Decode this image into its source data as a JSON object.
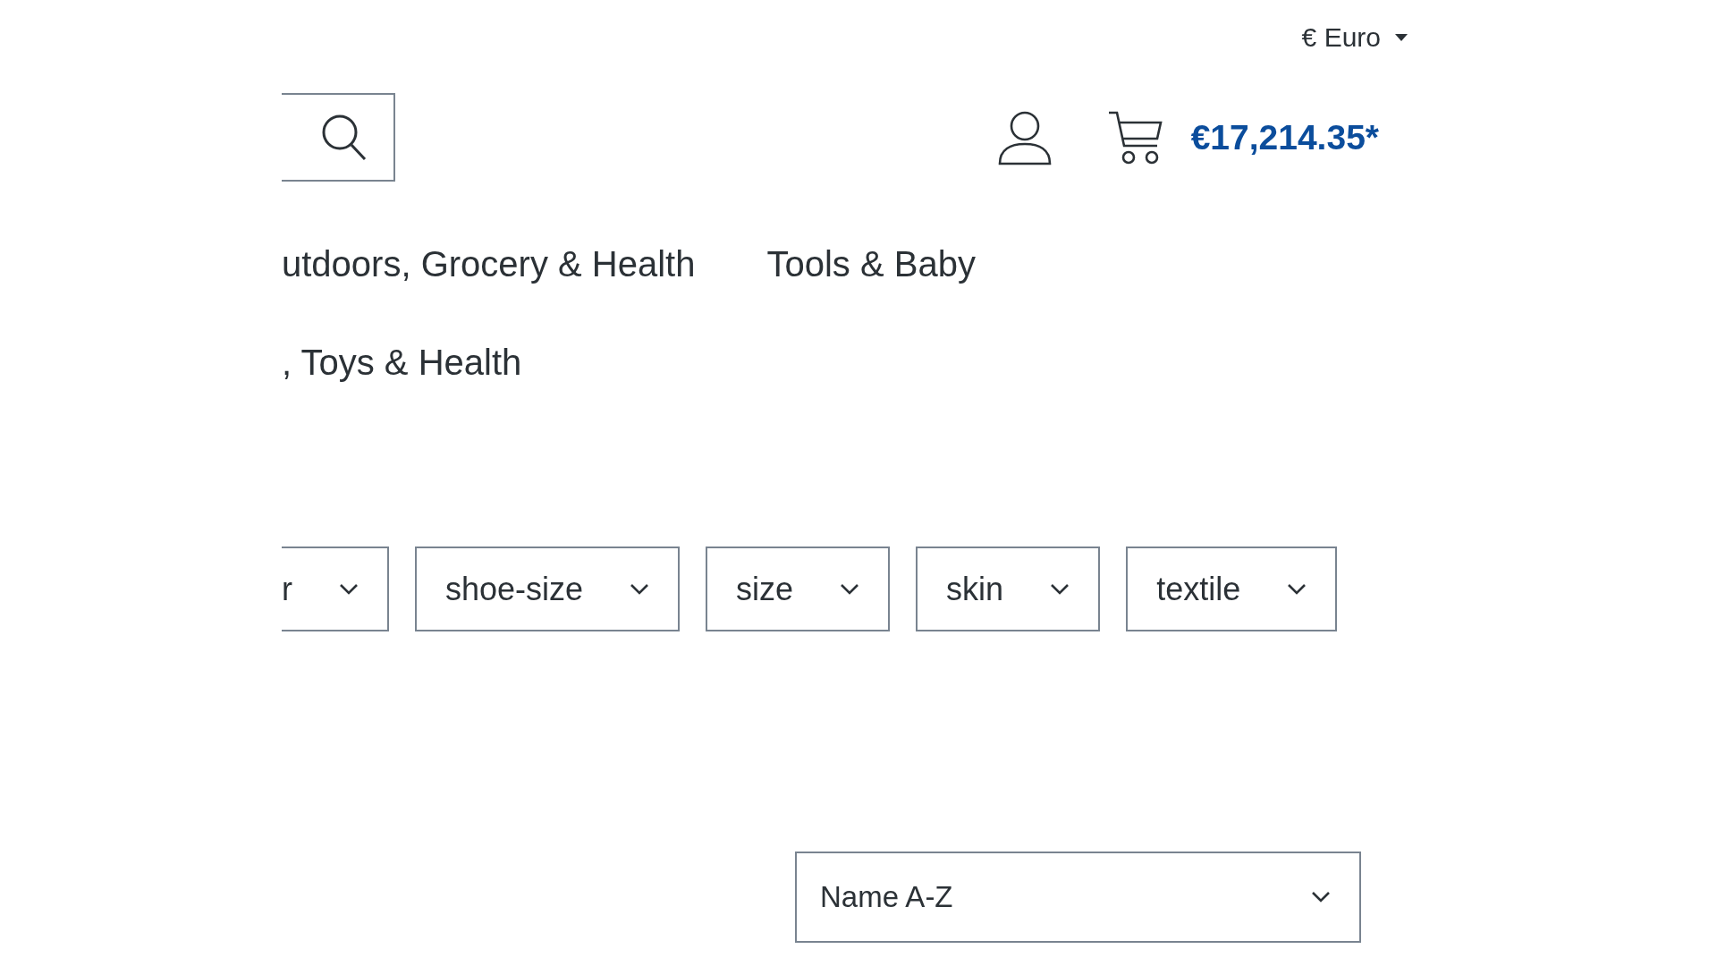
{
  "currency": {
    "label": "€ Euro"
  },
  "cart": {
    "total": "€17,214.35*"
  },
  "navigation": [
    {
      "items": [
        {
          "label": "utdoors, Grocery & Health"
        },
        {
          "label": "Tools & Baby"
        }
      ]
    },
    {
      "items": [
        {
          "label": ", Toys & Health"
        }
      ]
    }
  ],
  "filters": [
    {
      "label": "r",
      "cut": true
    },
    {
      "label": "shoe-size",
      "cut": false
    },
    {
      "label": "size",
      "cut": false
    },
    {
      "label": "skin",
      "cut": false
    },
    {
      "label": "textile",
      "cut": false
    }
  ],
  "sorting": {
    "value": "Name A-Z"
  }
}
